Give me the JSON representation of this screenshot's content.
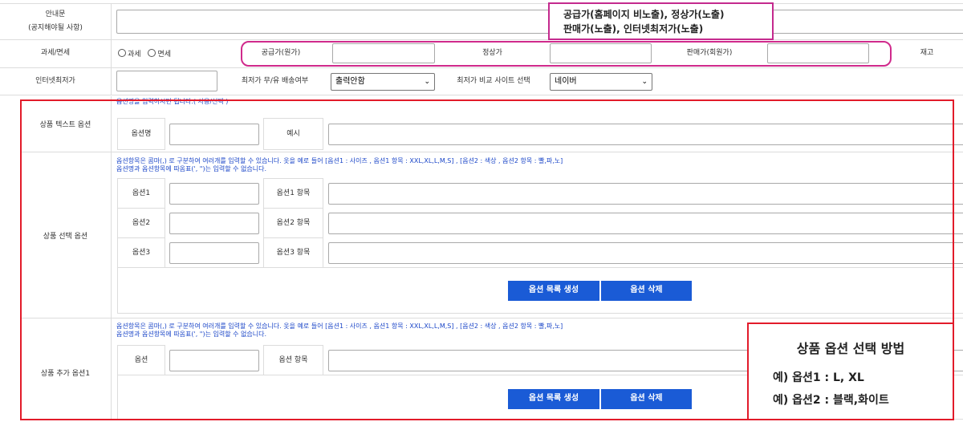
{
  "notice": {
    "label_line1": "안내문",
    "label_line2": "(공지해야될 사항)"
  },
  "callout_top": {
    "line1": "공급가(홈페이지  비노출), 정상가(노출)",
    "line2": "판매가(노출), 인터넷최저가(노출)"
  },
  "tax": {
    "label": "과세/면세",
    "opt1": "과세",
    "opt2": "면세"
  },
  "price": {
    "supply_label": "공급가(원가)",
    "regular_label": "정상가",
    "sale_label": "판매가(회원가)",
    "stock_label": "재고"
  },
  "lowest": {
    "label": "인터넷최저가",
    "shipping_label": "최저가 무/유 배송여부",
    "shipping_value": "출력안함",
    "compare_label": "최저가 비교 사이트 선택",
    "compare_value": "네이버"
  },
  "text_option": {
    "label": "상품 텍스트 옵션",
    "hint": "옵션명을 입력하시면 됩니다.( 사용/선택 )",
    "name_label": "옵션명",
    "example_label": "예시"
  },
  "select_option": {
    "label": "상품 선택 옵션",
    "hint1": "옵션항목은 콤마(,) 로 구분하여 여러개를 입력할 수 있습니다. 옷을 예로 들어 [옵션1 : 사이즈 , 옵션1 항목 : XXL,XL,L,M,S] , [옵션2 : 색상 , 옵션2 항목 : 빨,파,노]",
    "hint2": "옵션명과 옵션항목에 따옴표(', \")는 입력할 수 없습니다.",
    "rows": [
      {
        "name": "옵션1",
        "item": "옵션1 항목"
      },
      {
        "name": "옵션2",
        "item": "옵션2 항목"
      },
      {
        "name": "옵션3",
        "item": "옵션3 항목"
      }
    ],
    "create_btn": "옵션 목록 생성",
    "delete_btn": "옵션 삭제"
  },
  "add_option": {
    "label": "상품 추가 옵션1",
    "hint1": "옵션항목은 콤마(,) 로 구분하여 여러개를 입력할 수 있습니다. 옷을 예로 들어 [옵션1 : 사이즈 , 옵션1 항목 : XXL,XL,L,M,S] , [옵션2 : 색상 , 옵션2 항목 : 빨,파,노]",
    "hint2": "옵션명과 옵션항목에 따옴표(', \")는 입력할 수 없습니다.",
    "name_label": "옵션",
    "item_label": "옵션 항목",
    "create_btn": "옵션 목록 생성",
    "delete_btn": "옵션 삭제"
  },
  "callout_bottom": {
    "title": "상품 옵션 선택 방법",
    "ex1": "예) 옵션1 : L, XL",
    "ex2": "예) 옵션2 : 블랙,화이트"
  }
}
